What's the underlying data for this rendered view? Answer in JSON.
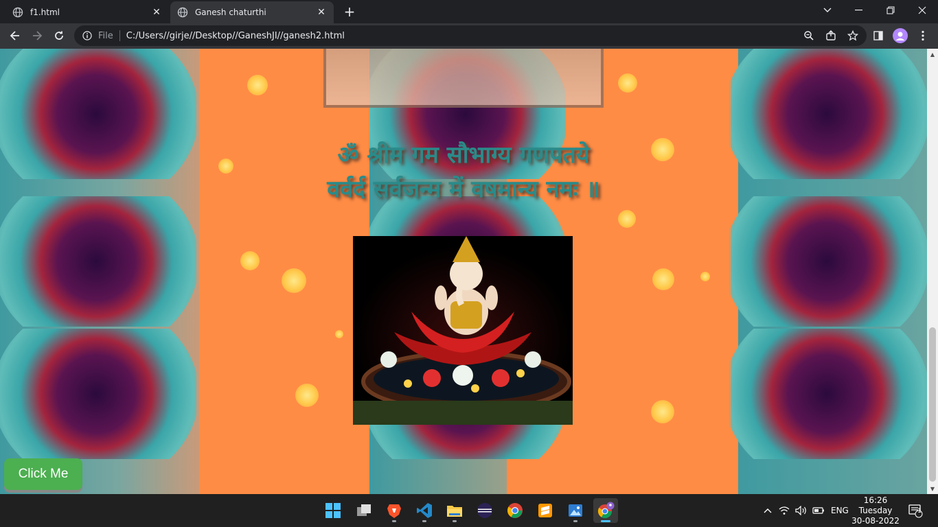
{
  "browser": {
    "tabs": [
      {
        "title": "f1.html",
        "icon": "globe-icon"
      },
      {
        "title": "Ganesh chaturthi",
        "icon": "globe-icon"
      }
    ],
    "omnibox": {
      "scheme_label": "File",
      "url": "C:/Users//girje//Desktop//GaneshJI//ganesh2.html"
    }
  },
  "page": {
    "mantra_line1": "ॐ श्रीम गम सौभाग्य गणपतये",
    "mantra_line2": "वर्वर्द सर्वजन्म में वषमान्य नमः ॥",
    "button_label": "Click Me",
    "colors": {
      "background": "#ff8c45",
      "mantra": "#2a8b8a",
      "button": "#4caf50"
    }
  },
  "taskbar": {
    "apps": [
      "windows-start",
      "task-view",
      "brave",
      "vs-code",
      "file-explorer",
      "eclipse",
      "chrome",
      "sublime-text",
      "photos",
      "chrome-profile"
    ],
    "tray": {
      "language": "ENG",
      "time": "16:26",
      "day": "Tuesday",
      "date": "30-08-2022",
      "notification_count": "1"
    }
  }
}
